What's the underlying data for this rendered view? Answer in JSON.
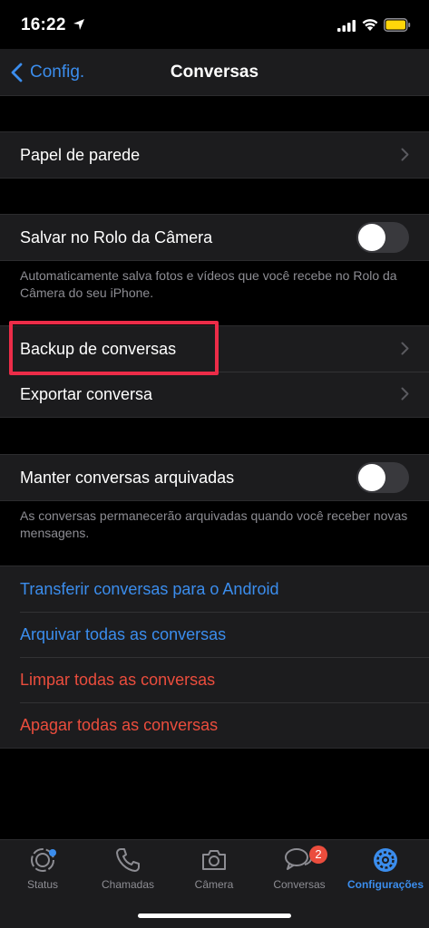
{
  "status_bar": {
    "time": "16:22"
  },
  "nav": {
    "back_label": "Config.",
    "title": "Conversas"
  },
  "wallpaper": {
    "label": "Papel de parede"
  },
  "camera_roll": {
    "label": "Salvar no Rolo da Câmera",
    "enabled": false,
    "note": "Automaticamente salva fotos e vídeos que você recebe no Rolo da Câmera do seu iPhone."
  },
  "backup": {
    "label": "Backup de conversas"
  },
  "export": {
    "label": "Exportar conversa"
  },
  "archived": {
    "label": "Manter conversas arquivadas",
    "enabled": false,
    "note": "As conversas permanecerão arquivadas quando você receber novas mensagens."
  },
  "actions": {
    "transfer": "Transferir conversas para o Android",
    "archive_all": "Arquivar todas as conversas",
    "clear_all": "Limpar todas as conversas",
    "delete_all": "Apagar todas as conversas"
  },
  "tabs": {
    "status": "Status",
    "calls": "Chamadas",
    "camera": "Câmera",
    "chats": "Conversas",
    "chats_badge": "2",
    "settings": "Configurações"
  },
  "colors": {
    "accent": "#3b8ded",
    "destructive": "#eb4d3d",
    "highlight": "#ec2c48"
  }
}
